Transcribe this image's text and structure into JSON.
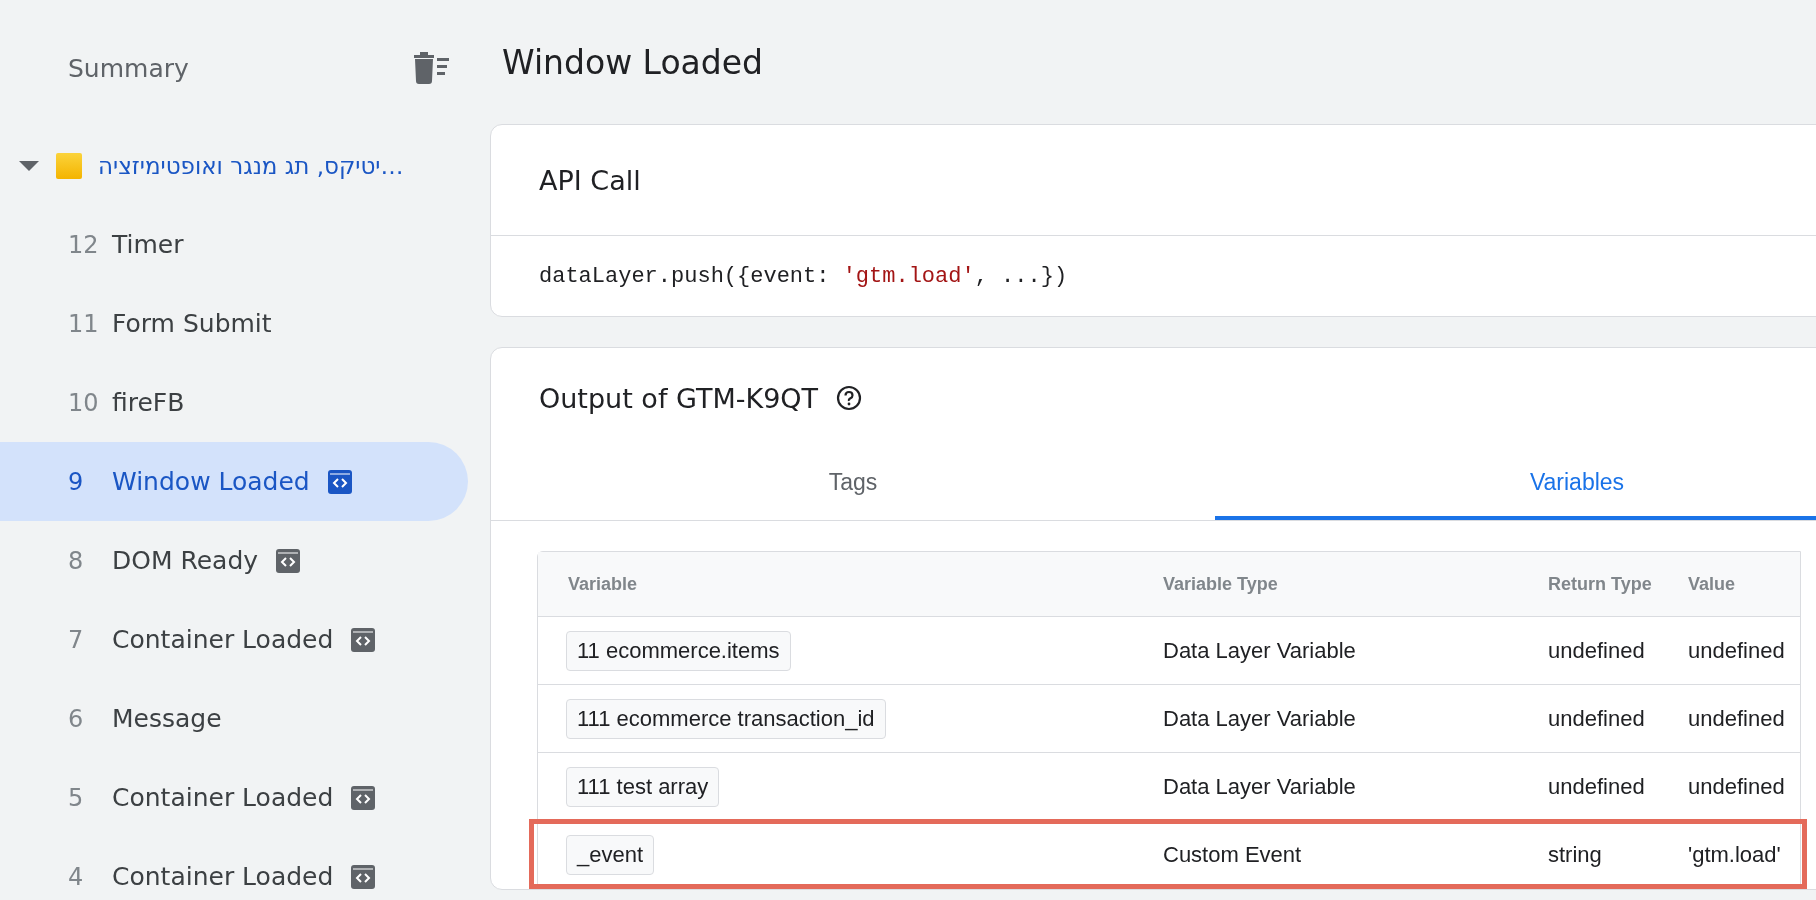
{
  "sidebar": {
    "title": "Summary",
    "group": {
      "label": "…יטיקס, תג מנגר ואופטימיזציה",
      "expanded": true
    },
    "items": [
      {
        "number": "12",
        "label": "Timer",
        "tag_icon": false,
        "selected": false
      },
      {
        "number": "11",
        "label": "Form Submit",
        "tag_icon": false,
        "selected": false
      },
      {
        "number": "10",
        "label": "fireFB",
        "tag_icon": false,
        "selected": false
      },
      {
        "number": "9",
        "label": "Window Loaded",
        "tag_icon": true,
        "selected": true
      },
      {
        "number": "8",
        "label": "DOM Ready",
        "tag_icon": true,
        "selected": false
      },
      {
        "number": "7",
        "label": "Container Loaded",
        "tag_icon": true,
        "selected": false
      },
      {
        "number": "6",
        "label": "Message",
        "tag_icon": false,
        "selected": false
      },
      {
        "number": "5",
        "label": "Container Loaded",
        "tag_icon": true,
        "selected": false
      },
      {
        "number": "4",
        "label": "Container Loaded",
        "tag_icon": true,
        "selected": false
      }
    ]
  },
  "page_title": "Window Loaded",
  "api_call": {
    "title": "API Call",
    "code_before": "dataLayer.push({event: ",
    "code_string": "'gtm.load'",
    "code_after": ", ...})"
  },
  "output": {
    "title": "Output of GTM-K9QT",
    "tabs": [
      {
        "label": "Tags",
        "selected": false
      },
      {
        "label": "Variables",
        "selected": true
      }
    ],
    "table": {
      "columns": [
        "Variable",
        "Variable Type",
        "Return Type",
        "Value"
      ],
      "rows": [
        {
          "variable": "11 ecommerce.items",
          "type": "Data Layer Variable",
          "return_type": "undefined",
          "value": "undefined",
          "highlighted": false
        },
        {
          "variable": "111 ecommerce transaction_id",
          "type": "Data Layer Variable",
          "return_type": "undefined",
          "value": "undefined",
          "highlighted": false
        },
        {
          "variable": "111 test array",
          "type": "Data Layer Variable",
          "return_type": "undefined",
          "value": "undefined",
          "highlighted": false
        },
        {
          "variable": "_event",
          "type": "Custom Event",
          "return_type": "string",
          "value": "'gtm.load'",
          "highlighted": true
        }
      ]
    }
  }
}
